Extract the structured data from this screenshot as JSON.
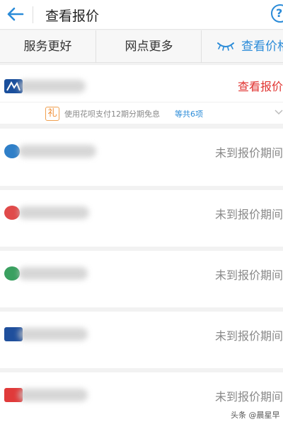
{
  "header": {
    "title": "查看报价",
    "help_glyph": "?"
  },
  "tabs": [
    "服务更好",
    "网点更多",
    "查看价格"
  ],
  "first_card": {
    "status": "查看报价",
    "promo": {
      "badge": "礼",
      "text": "使用花呗支付12期分期免息",
      "link": "等共6项"
    }
  },
  "insurers": [
    {
      "status": "未到报价期间"
    },
    {
      "status": "未到报价期间"
    },
    {
      "status": "未到报价期间"
    },
    {
      "status": "未到报价期间"
    },
    {
      "status": "未到报价期间"
    }
  ],
  "watermark": "头条 @晨星早",
  "colors": {
    "accent": "#2a8bd8",
    "quote_red": "#e0322f",
    "gift_orange": "#f08c32"
  }
}
